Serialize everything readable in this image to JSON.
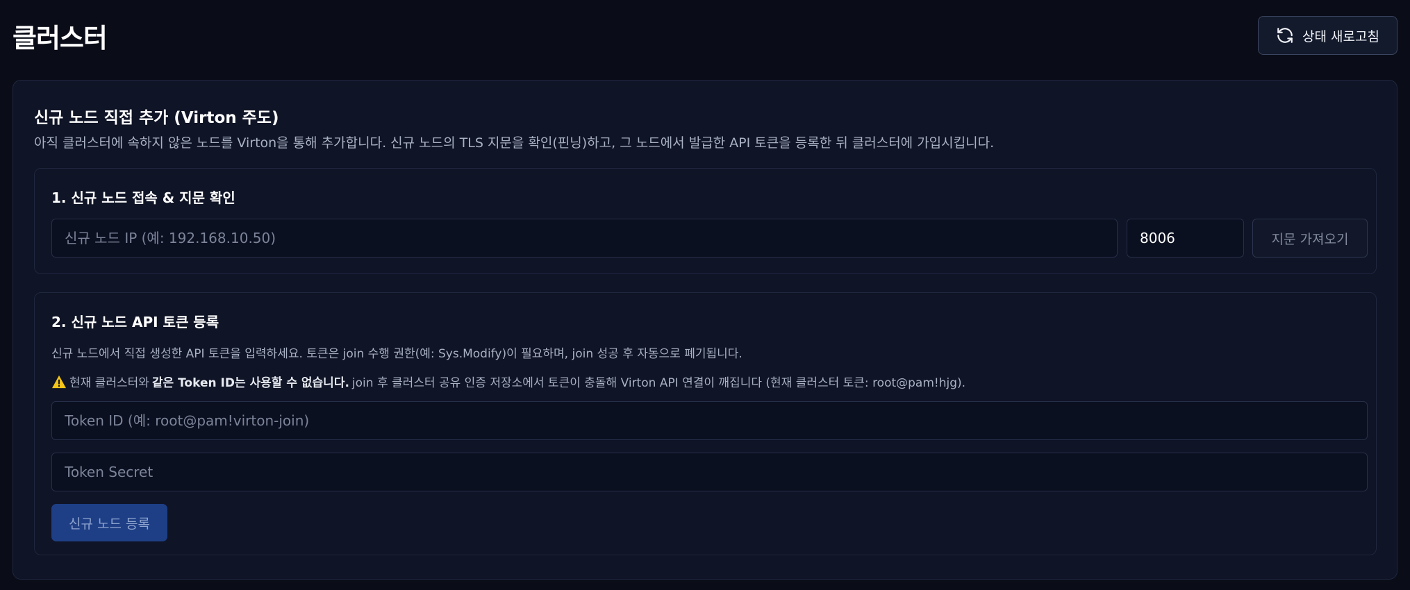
{
  "header": {
    "title": "클러스터",
    "refresh_label": "상태 새로고침"
  },
  "panel": {
    "title": "신규 노드 직접 추가 (Virton 주도)",
    "description": "아직 클러스터에 속하지 않은 노드를 Virton을 통해 추가합니다. 신규 노드의 TLS 지문을 확인(핀닝)하고, 그 노드에서 발급한 API 토큰을 등록한 뒤 클러스터에 가입시킵니다."
  },
  "step1": {
    "title": "1. 신규 노드 접속 & 지문 확인",
    "ip_placeholder": "신규 노드 IP (예: 192.168.10.50)",
    "ip_value": "",
    "port_value": "8006",
    "fetch_label": "지문 가져오기"
  },
  "step2": {
    "title": "2. 신규 노드 API 토큰 등록",
    "description": "신규 노드에서 직접 생성한 API 토큰을 입력하세요. 토큰은 join 수행 권한(예: Sys.Modify)이 필요하며, join 성공 후 자동으로 폐기됩니다.",
    "warning_prefix": "현재 클러스터와 ",
    "warning_bold": "같은 Token ID는 사용할 수 없습니다.",
    "warning_suffix": " join 후 클러스터 공유 인증 저장소에서 토큰이 충돌해 Virton API 연결이 깨집니다 (현재 클러스터 토큰: root@pam!hjg).",
    "token_id_placeholder": "Token ID (예: root@pam!virton-join)",
    "token_secret_placeholder": "Token Secret",
    "register_label": "신규 노드 등록"
  },
  "icons": {
    "refresh": "refresh-icon",
    "warning": "warning-icon"
  },
  "colors": {
    "background": "#0a0d17",
    "panel": "#0f1426",
    "primary_button": "#1e3f86",
    "warning": "#f5c518"
  }
}
